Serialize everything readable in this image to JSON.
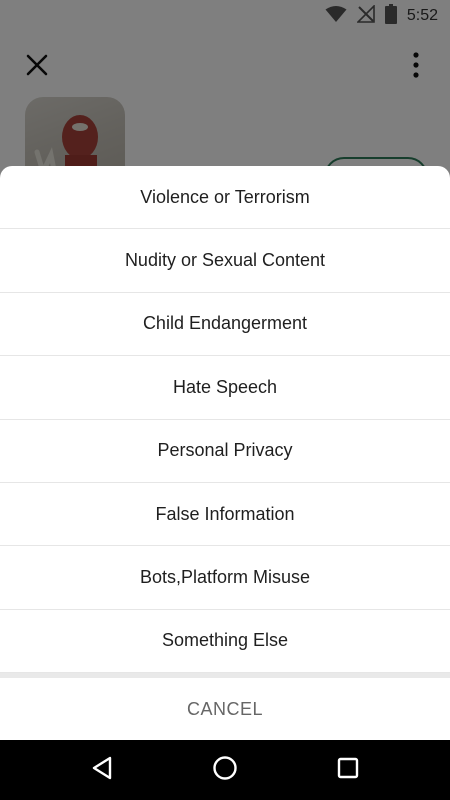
{
  "status_bar": {
    "time": "5:52",
    "icons": [
      "wifi-icon",
      "no-signal-icon",
      "battery-icon"
    ]
  },
  "header": {
    "close_icon": "close-icon",
    "more_icon": "more-vert-icon"
  },
  "report_sheet": {
    "options": [
      {
        "label": "Violence or Terrorism"
      },
      {
        "label": "Nudity or Sexual Content"
      },
      {
        "label": "Child Endangerment"
      },
      {
        "label": "Hate Speech"
      },
      {
        "label": "Personal Privacy"
      },
      {
        "label": "False Information"
      },
      {
        "label": "Bots,Platform Misuse"
      },
      {
        "label": "Something Else"
      }
    ],
    "cancel_label": "CANCEL"
  },
  "nav_bar": {
    "icons": [
      "back-icon",
      "home-icon",
      "recents-icon"
    ]
  },
  "colors": {
    "scrim": "rgba(0,0,0,0.5)",
    "follow_button_border": "#2f7d5a",
    "cancel_text": "#666666"
  }
}
